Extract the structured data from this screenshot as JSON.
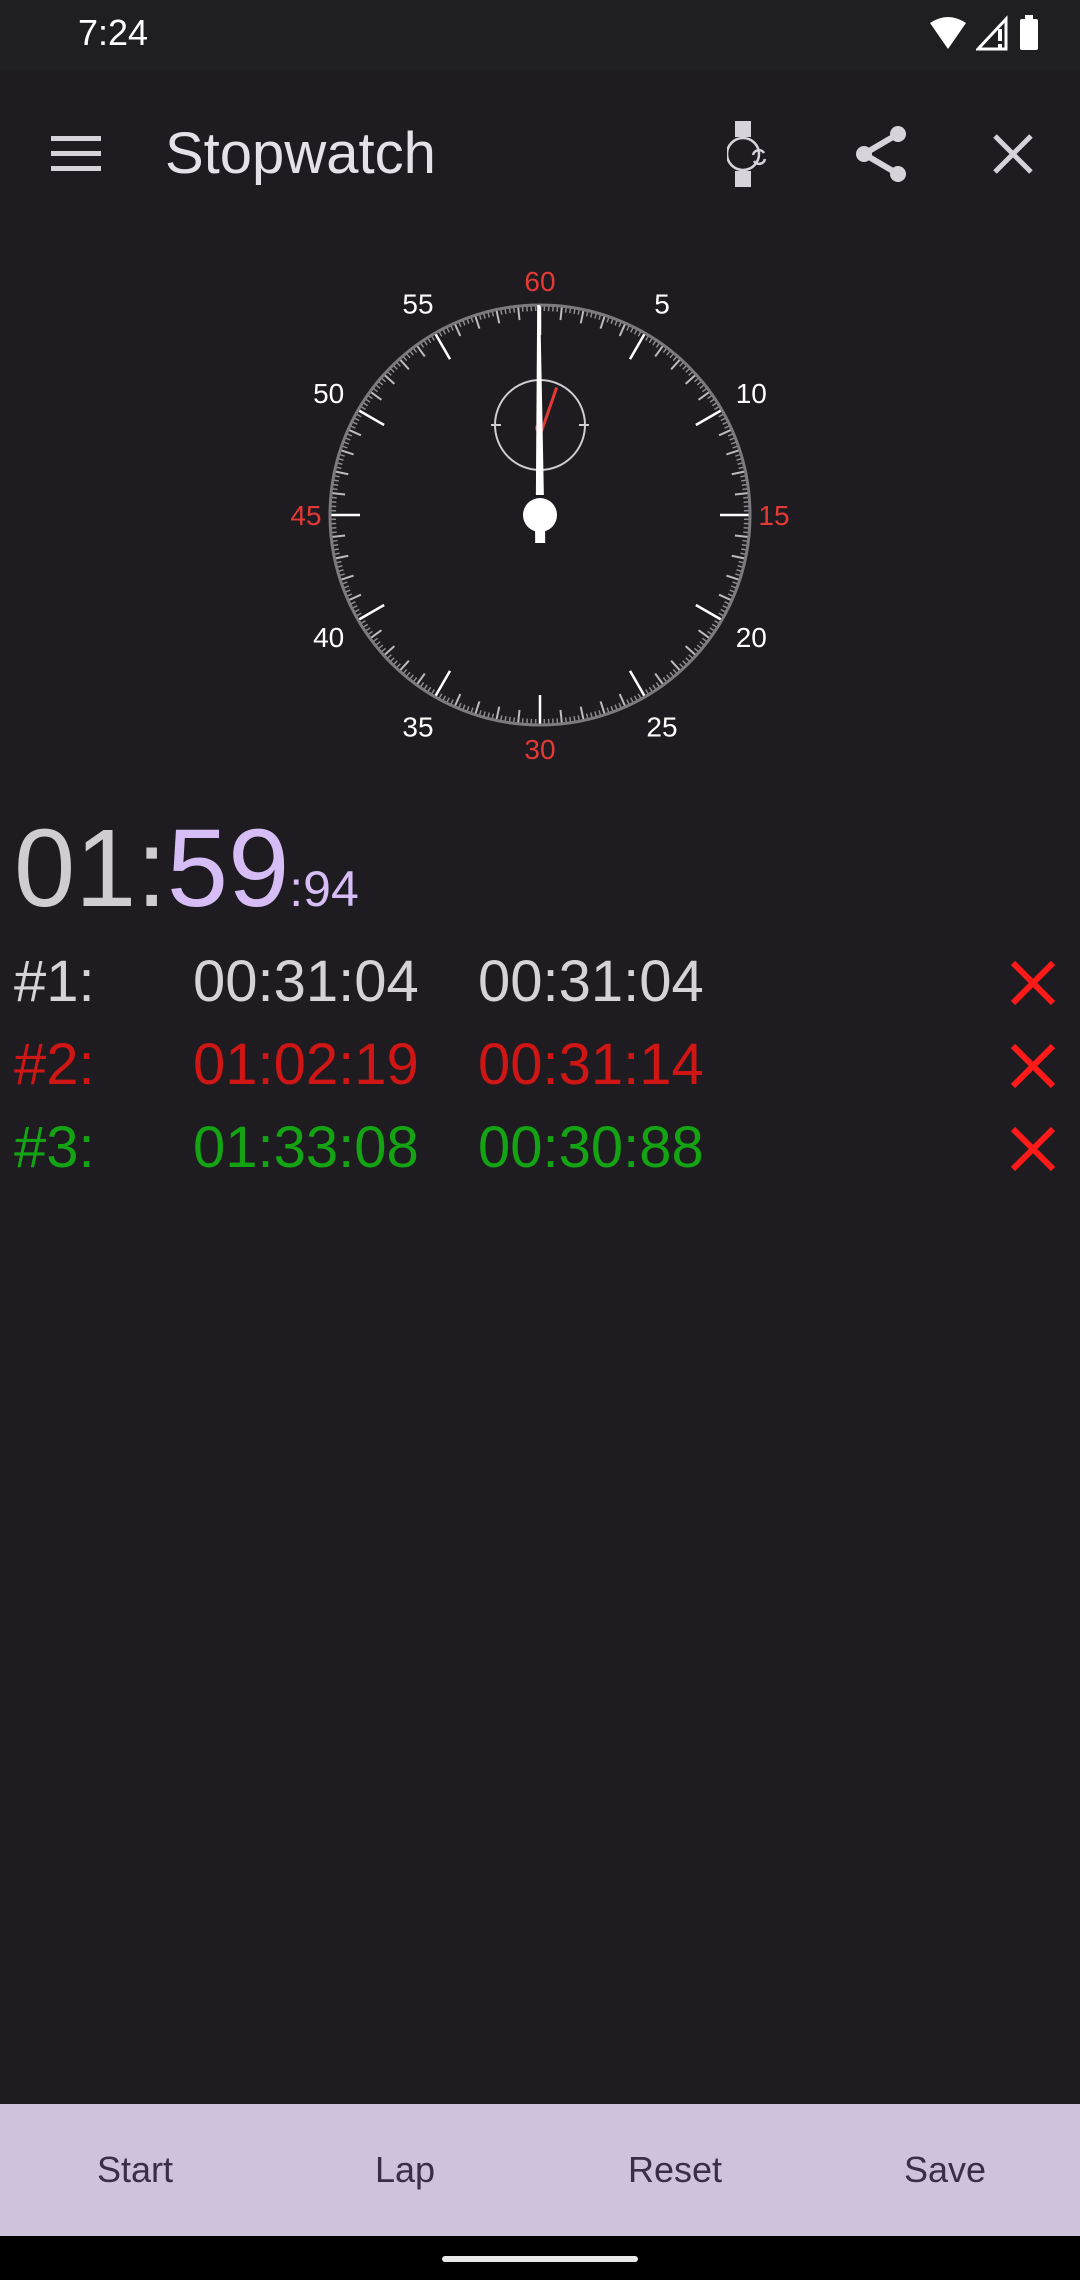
{
  "status_bar": {
    "time": "7:24",
    "icons": [
      "wifi-icon",
      "cellular-signal-icon",
      "battery-icon"
    ]
  },
  "app_bar": {
    "title": "Stopwatch",
    "icons": [
      "menu-icon",
      "watch-sync-icon",
      "share-icon",
      "close-icon"
    ]
  },
  "dial": {
    "labels": [
      {
        "value": "60",
        "accent": true
      },
      {
        "value": "5",
        "accent": false
      },
      {
        "value": "10",
        "accent": false
      },
      {
        "value": "15",
        "accent": true
      },
      {
        "value": "20",
        "accent": false
      },
      {
        "value": "25",
        "accent": false
      },
      {
        "value": "30",
        "accent": true
      },
      {
        "value": "35",
        "accent": false
      },
      {
        "value": "40",
        "accent": false
      },
      {
        "value": "45",
        "accent": true
      },
      {
        "value": "50",
        "accent": false
      },
      {
        "value": "55",
        "accent": false
      }
    ],
    "seconds": 59.94,
    "minutes": 1,
    "accent_color": "#e53935",
    "label_color": "#ffffff"
  },
  "main_time": {
    "hours_minutes": "01:",
    "seconds": "59",
    "centiseconds": ":94"
  },
  "laps": [
    {
      "number": "#1:",
      "total": "00:31:04",
      "split": "00:31:04",
      "color": "#d5d3d8"
    },
    {
      "number": "#2:",
      "total": "01:02:19",
      "split": "00:31:14",
      "color": "#d01515"
    },
    {
      "number": "#3:",
      "total": "01:33:08",
      "split": "00:30:88",
      "color": "#13a313"
    }
  ],
  "lap_delete_color": "#ff1a1a",
  "bottom_bar": {
    "buttons": [
      "Start",
      "Lap",
      "Reset",
      "Save"
    ]
  }
}
